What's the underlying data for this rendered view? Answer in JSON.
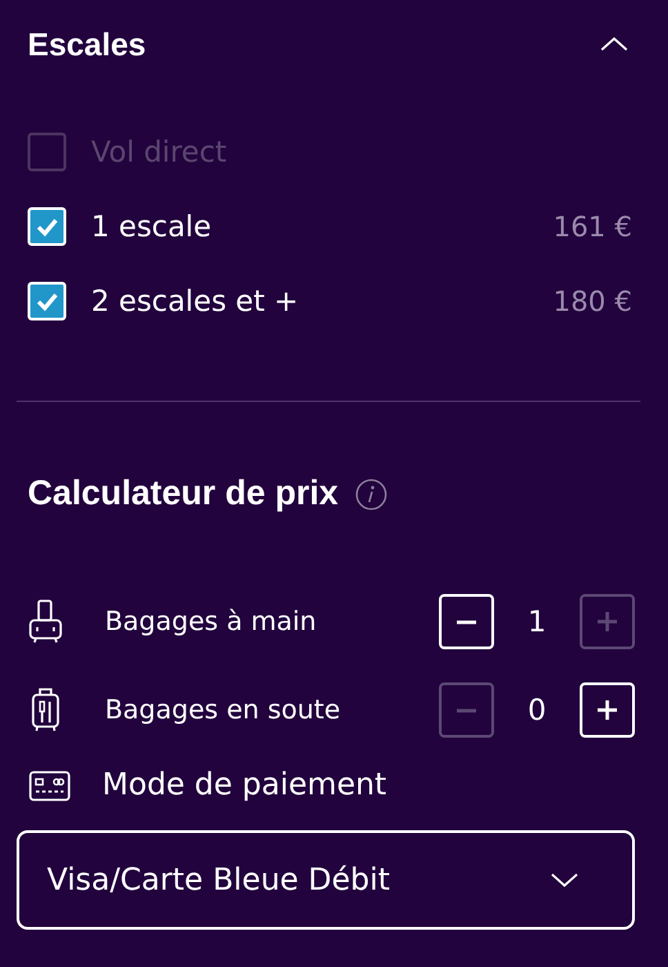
{
  "stops": {
    "title": "Escales",
    "expanded": true,
    "options": [
      {
        "label": "Vol direct",
        "checked": false,
        "disabled": true
      },
      {
        "label": "1 escale",
        "price": "161 €",
        "checked": true,
        "disabled": false
      },
      {
        "label": "2 escales et +",
        "price": "180 €",
        "checked": true,
        "disabled": false
      }
    ]
  },
  "calculator": {
    "title": "Calculateur de prix",
    "baggage": [
      {
        "kind": "hand",
        "label": "Bagages à main",
        "count": "1",
        "minus_disabled": false,
        "plus_disabled": true
      },
      {
        "kind": "hold",
        "label": "Bagages en soute",
        "count": "0",
        "minus_disabled": true,
        "plus_disabled": false
      }
    ],
    "payment": {
      "label": "Mode de paiement",
      "value": "Visa/Carte Bleue Débit"
    }
  }
}
